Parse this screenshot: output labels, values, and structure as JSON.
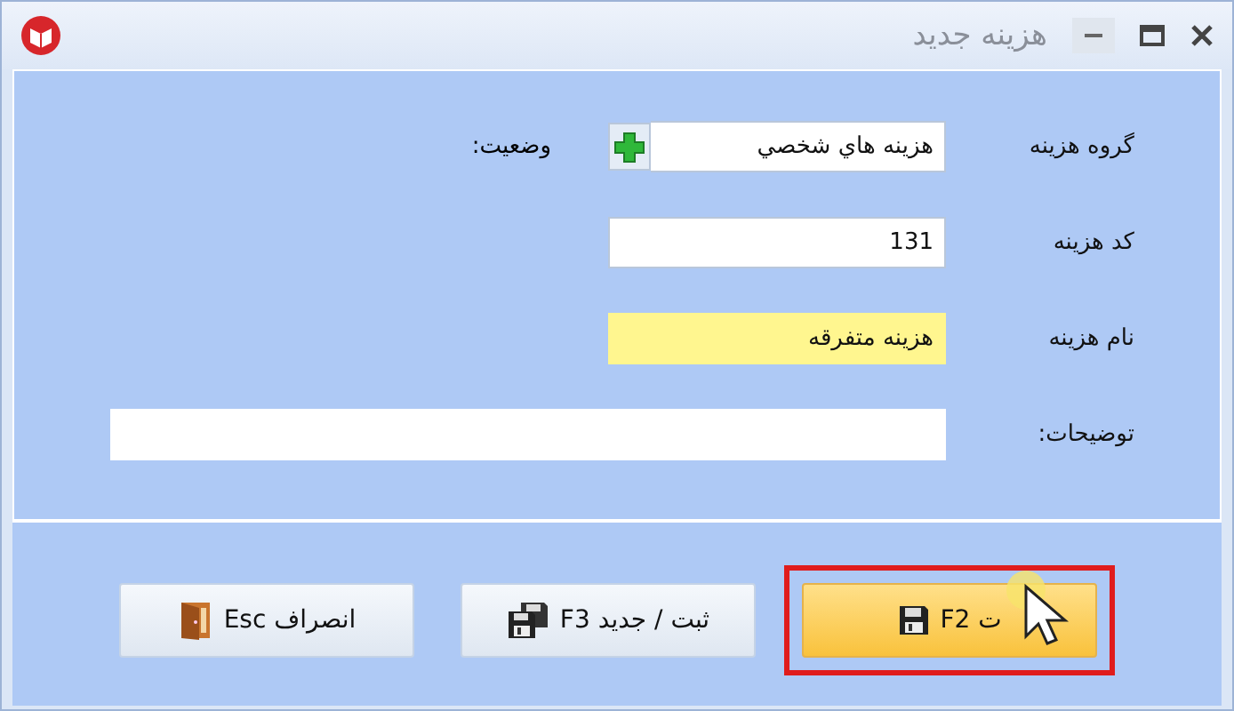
{
  "window": {
    "title": "هزینه جدید"
  },
  "fields": [
    {
      "label": "گروه هزینه",
      "value": "هزینه هاي شخصي",
      "kind": "lookup",
      "focused": false
    },
    {
      "label": "کد هزینه",
      "value": "131",
      "kind": "text",
      "focused": false
    },
    {
      "label": "نام هزینه",
      "value": "هزینه متفرقه",
      "kind": "text",
      "focused": true
    },
    {
      "label": "توضیحات:",
      "kind": "wide",
      "focused": false
    }
  ],
  "status_label": "وضعیت:",
  "buttons": [
    {
      "label": "ت F2",
      "kind": "save",
      "selected": true
    },
    {
      "label": "ثبت / جدید F3",
      "kind": "save-new",
      "selected": false
    },
    {
      "label": "انصراف Esc",
      "kind": "exit",
      "selected": false
    }
  ]
}
